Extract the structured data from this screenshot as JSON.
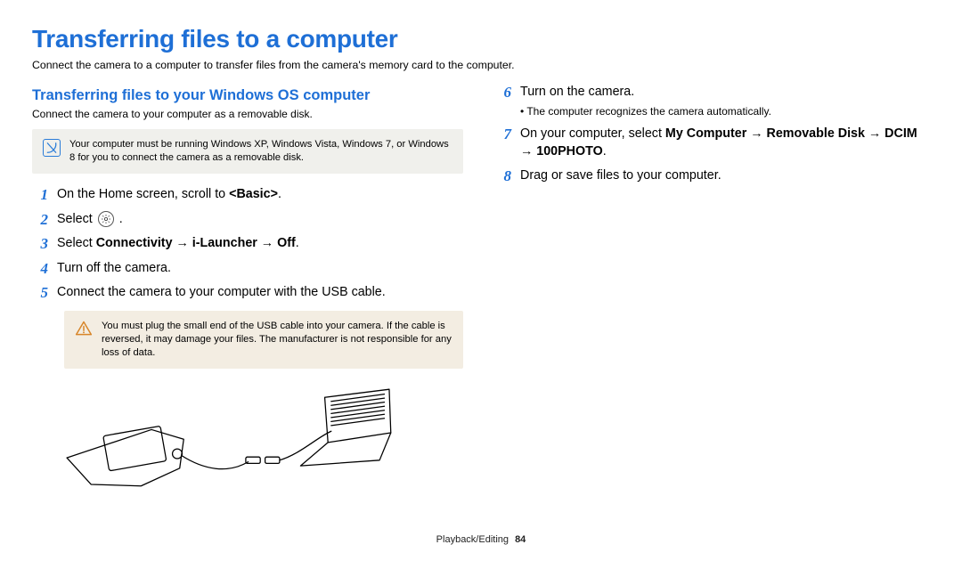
{
  "page": {
    "title": "Transferring files to a computer",
    "intro": "Connect the camera to a computer to transfer files from the camera's memory card to the computer.",
    "footer_section": "Playback/Editing",
    "footer_page": "84"
  },
  "section": {
    "heading": "Transferring files to your Windows OS computer",
    "sub": "Connect the camera to your computer as a removable disk.",
    "info_note": "Your computer must be running Windows XP, Windows Vista, Windows 7, or Windows 8 for you to connect the camera as a removable disk."
  },
  "steps": {
    "s1_pre": "On the Home screen, scroll to ",
    "s1_bold": "<Basic>",
    "s1_post": ".",
    "s2": "Select ",
    "s2_post": " .",
    "s3_pre": "Select ",
    "s3_bold": "Connectivity → i-Launcher → Off",
    "s3_post": ".",
    "s4": "Turn off the camera.",
    "s5": "Connect the camera to your computer with the USB cable.",
    "warn": "You must plug the small end of the USB cable into your camera. If the cable is reversed, it may damage your files. The manufacturer is not responsible for any loss of data.",
    "s6": "Turn on the camera.",
    "s6_sub": "The computer recognizes the camera automatically.",
    "s7_pre": "On your computer, select ",
    "s7_bold": "My Computer → Removable Disk → DCIM → 100PHOTO",
    "s7_post": ".",
    "s8": "Drag or save files to your computer."
  }
}
